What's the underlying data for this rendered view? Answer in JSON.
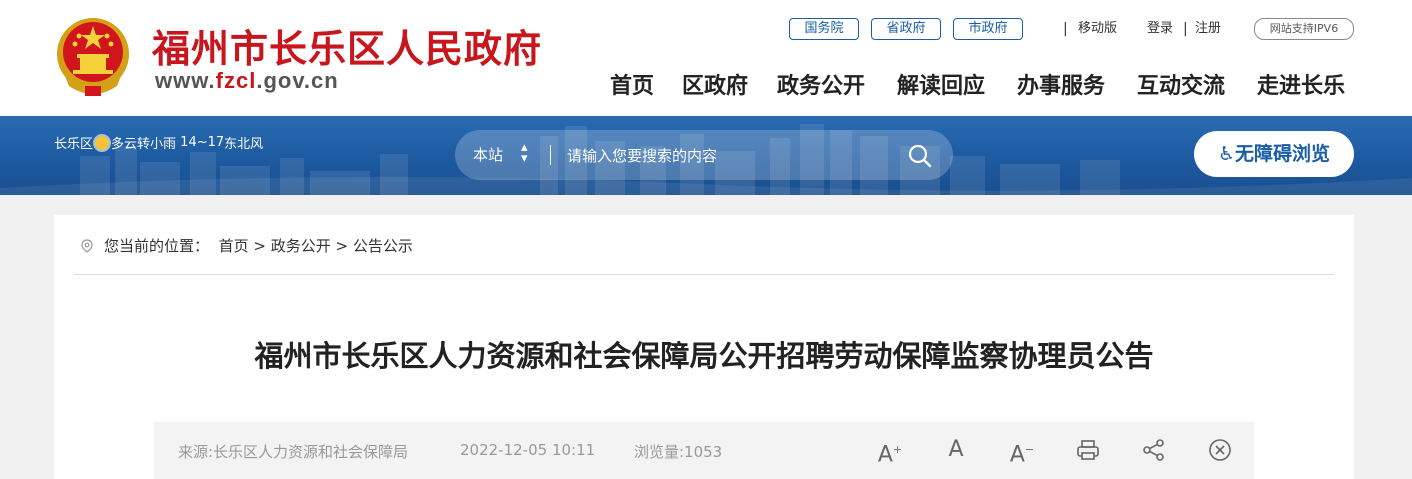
{
  "header": {
    "title": "福州市长乐区人民政府",
    "url_prefix": "www.",
    "url_highlight": "fzcl",
    "url_suffix": ".gov.cn",
    "top_links": [
      "国务院",
      "省政府",
      "市政府"
    ],
    "mobile": "移动版",
    "login": "登录",
    "register": "注册",
    "ipv6": "网站支持IPV6",
    "nav": [
      "首页",
      "区政府",
      "政务公开",
      "解读回应",
      "办事服务",
      "互动交流",
      "走进长乐"
    ]
  },
  "banner": {
    "weather": {
      "district": "长乐区",
      "condition": "多云转小雨",
      "temp": "14~17",
      "wind": "东北风"
    },
    "search": {
      "scope": "本站",
      "placeholder": "请输入您要搜索的内容"
    },
    "accessibility": "无障碍浏览"
  },
  "breadcrumb": {
    "label": "您当前的位置：",
    "items": [
      "首页",
      "政务公开",
      "公告公示"
    ]
  },
  "article": {
    "title": "福州市长乐区人力资源和社会保障局公开招聘劳动保障监察协理员公告",
    "source": "来源:长乐区人力资源和社会保障局",
    "date": "2022-12-05 10:11",
    "views": "浏览量:1053"
  },
  "tools": [
    "font-increase-icon",
    "font-normal-icon",
    "font-decrease-icon",
    "print-icon",
    "share-icon",
    "close-icon"
  ],
  "colors": {
    "brand_red": "#c8161d",
    "brand_blue": "#1a5ea8"
  }
}
